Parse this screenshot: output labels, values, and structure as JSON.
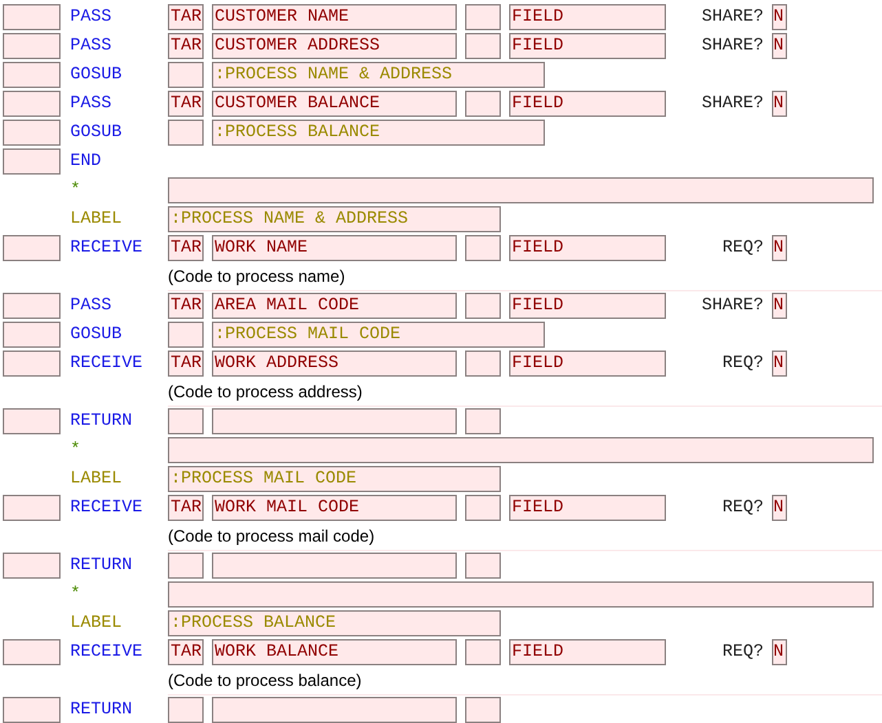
{
  "lines": [
    {
      "kind": "call",
      "verb": "PASS",
      "prefix": "TAR",
      "name": "CUSTOMER NAME",
      "field": "FIELD",
      "flag_label": "SHARE?",
      "flag": "N"
    },
    {
      "kind": "call",
      "verb": "PASS",
      "prefix": "TAR",
      "name": "CUSTOMER ADDRESS",
      "field": "FIELD",
      "flag_label": "SHARE?",
      "flag": "N"
    },
    {
      "kind": "gosub",
      "verb": "GOSUB",
      "target": ":PROCESS NAME & ADDRESS"
    },
    {
      "kind": "call",
      "verb": "PASS",
      "prefix": "TAR",
      "name": "CUSTOMER BALANCE",
      "field": "FIELD",
      "flag_label": "SHARE?",
      "flag": "N"
    },
    {
      "kind": "gosub",
      "verb": "GOSUB",
      "target": ":PROCESS BALANCE"
    },
    {
      "kind": "end",
      "verb": "END"
    },
    {
      "kind": "comment",
      "verb": "*"
    },
    {
      "kind": "label",
      "verb": "LABEL",
      "target": ":PROCESS NAME & ADDRESS"
    },
    {
      "kind": "call",
      "verb": "RECEIVE",
      "prefix": "TAR",
      "name": "WORK NAME",
      "field": "FIELD",
      "flag_label": "REQ?",
      "flag": "N"
    },
    {
      "kind": "note",
      "text": "(Code to process name)"
    },
    {
      "kind": "call",
      "verb": "PASS",
      "prefix": "TAR",
      "name": "AREA MAIL CODE",
      "field": "FIELD",
      "flag_label": "SHARE?",
      "flag": "N"
    },
    {
      "kind": "gosub",
      "verb": "GOSUB",
      "target": ":PROCESS MAIL CODE"
    },
    {
      "kind": "call",
      "verb": "RECEIVE",
      "prefix": "TAR",
      "name": "WORK ADDRESS",
      "field": "FIELD",
      "flag_label": "REQ?",
      "flag": "N"
    },
    {
      "kind": "note",
      "text": "(Code to process address)"
    },
    {
      "kind": "return",
      "verb": "RETURN"
    },
    {
      "kind": "comment",
      "verb": "*"
    },
    {
      "kind": "label",
      "verb": "LABEL",
      "target": ":PROCESS MAIL CODE"
    },
    {
      "kind": "call",
      "verb": "RECEIVE",
      "prefix": "TAR",
      "name": "WORK MAIL CODE",
      "field": "FIELD",
      "flag_label": "REQ?",
      "flag": "N"
    },
    {
      "kind": "note",
      "text": "(Code to process mail code)"
    },
    {
      "kind": "return",
      "verb": "RETURN"
    },
    {
      "kind": "comment",
      "verb": "*"
    },
    {
      "kind": "label",
      "verb": "LABEL",
      "target": ":PROCESS BALANCE"
    },
    {
      "kind": "call",
      "verb": "RECEIVE",
      "prefix": "TAR",
      "name": "WORK BALANCE",
      "field": "FIELD",
      "flag_label": "REQ?",
      "flag": "N"
    },
    {
      "kind": "note",
      "text": "(Code to process balance)"
    },
    {
      "kind": "return",
      "verb": "RETURN"
    }
  ]
}
